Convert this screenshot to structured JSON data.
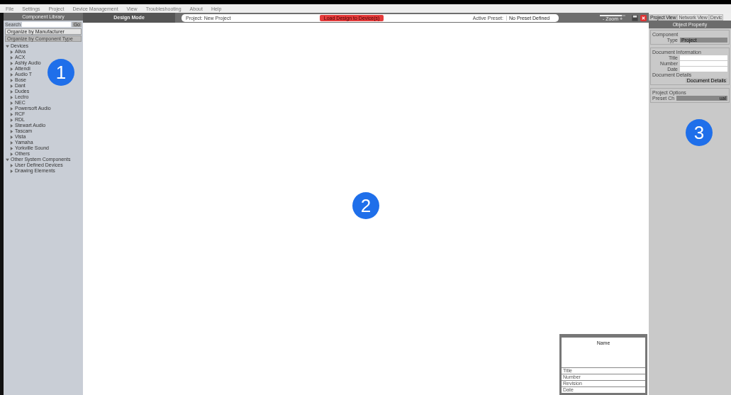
{
  "menu": [
    "File",
    "Settings",
    "Project",
    "Device Management",
    "View",
    "Troubleshooting",
    "About",
    "Help"
  ],
  "library": {
    "title": "Component Library",
    "search_label": "Search",
    "search_button": "Go",
    "tabs": [
      {
        "label": "Organize by Manufacturer",
        "selected": true
      },
      {
        "label": "Organize by Component Type",
        "selected": false
      }
    ],
    "tree": [
      {
        "label": "Devices",
        "expanded": true,
        "children": [
          {
            "label": "Allva"
          },
          {
            "label": "ACX"
          },
          {
            "label": "Ashly Audio"
          },
          {
            "label": "Attendi"
          },
          {
            "label": "Audio T"
          },
          {
            "label": "Bose"
          },
          {
            "label": "Dant"
          },
          {
            "label": "Dudes"
          },
          {
            "label": "Lectro"
          },
          {
            "label": "NEC"
          },
          {
            "label": "Powersoft Audio"
          },
          {
            "label": "RCF"
          },
          {
            "label": "RDL"
          },
          {
            "label": "Stewart Audio"
          },
          {
            "label": "Tascam"
          },
          {
            "label": "Vista"
          },
          {
            "label": "Yamaha"
          },
          {
            "label": "Yorkville Sound"
          },
          {
            "label": "Others"
          }
        ]
      },
      {
        "label": "Other System Components",
        "expanded": true,
        "children": [
          {
            "label": "User Defined Devices"
          },
          {
            "label": "Drawing Elements"
          }
        ]
      }
    ]
  },
  "design": {
    "mode": "Design Mode",
    "project": "Project: New Project",
    "load_button": "Load Design to Device(s)",
    "preset_label": "Active Preset:",
    "preset_value": "No Preset Defined",
    "zoom_label": "-   Zoom   +",
    "zoom": {
      "level": 0.85
    }
  },
  "title_block": {
    "name": "Name",
    "rows": [
      "Title",
      "Number",
      "Revision",
      "Date"
    ]
  },
  "properties": {
    "tabs": [
      {
        "label": "Project View",
        "selected": true
      },
      {
        "label": "Network View",
        "selected": false
      },
      {
        "label": "Devic",
        "selected": false
      }
    ],
    "title": "Object Property",
    "component_heading": "Component",
    "type_label": "Type",
    "type_value": "Project",
    "doc_heading": "Document Information",
    "fields": [
      "Title",
      "Number",
      "Date"
    ],
    "details_label": "Document Details",
    "details_button": "Document Details",
    "options_heading": "Project Options",
    "preset_label": "Preset Ch",
    "preset_value": "ual"
  },
  "callouts": [
    "1",
    "2",
    "3"
  ]
}
